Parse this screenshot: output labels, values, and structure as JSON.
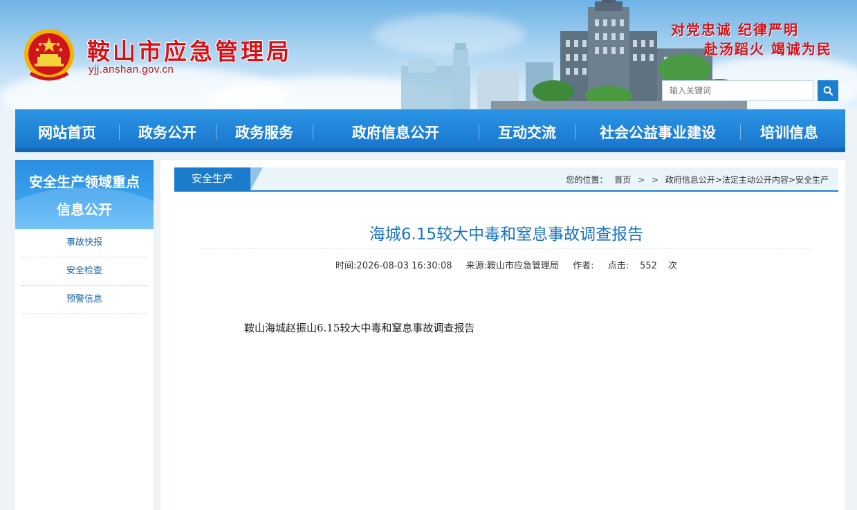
{
  "header": {
    "site_title": "鞍山市应急管理局",
    "site_domain": "yjj.anshan.gov.cn",
    "motto_line1": "对党忠诚 纪律严明",
    "motto_line2": "赴汤蹈火 竭诚为民",
    "search_placeholder": "输入关键词",
    "search_icon": "search-icon",
    "emblem_icon": "national-emblem-icon"
  },
  "nav": {
    "items": [
      "网站首页",
      "政务公开",
      "政务服务",
      "政府信息公开",
      "互动交流",
      "社会公益事业建设",
      "培训信息"
    ]
  },
  "sidebar": {
    "title_line1": "安全生产领域重点",
    "title_line2": "信息公开",
    "items": [
      "事故快报",
      "安全检查",
      "预警信息"
    ]
  },
  "section": {
    "tab_label": "安全生产",
    "breadcrumb_prefix": "您的位置：",
    "breadcrumb_home": "首页",
    "breadcrumb_gt1": ">",
    "breadcrumb_gt2": ">",
    "breadcrumb_path": "政府信息公开>法定主动公开内容>安全生产"
  },
  "article": {
    "title": "海城6.15较大中毒和窒息事故调查报告",
    "time": "时间:2026-08-03 16:30:08",
    "source": "来源:鞍山市应急管理局",
    "author": "作者:",
    "clicks_label": "点击:",
    "clicks_value": "552",
    "clicks_unit": "次",
    "body": "鞍山海城赵振山6.15较大中毒和窒息事故调查报告"
  },
  "colors": {
    "brand_red": "#d4121a",
    "nav_blue": "#1b7ccc",
    "title_blue": "#1a73c3"
  }
}
